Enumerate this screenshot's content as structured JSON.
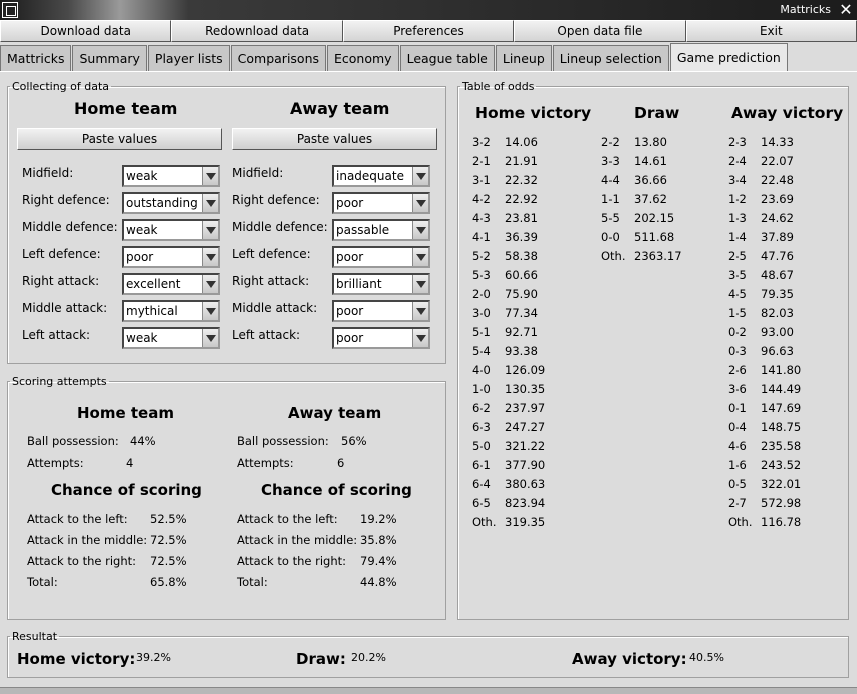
{
  "window": {
    "title": "Mattricks"
  },
  "toolbar": [
    "Download data",
    "Redownload data",
    "Preferences",
    "Open data file",
    "Exit"
  ],
  "tabs": [
    "Mattricks",
    "Summary",
    "Player lists",
    "Comparisons",
    "Economy",
    "League table",
    "Lineup",
    "Lineup selection",
    "Game prediction"
  ],
  "active_tab": "Game prediction",
  "collecting": {
    "title": "Collecting of data",
    "home": {
      "heading": "Home team",
      "paste": "Paste values",
      "rows": [
        {
          "label": "Midfield:",
          "value": "weak"
        },
        {
          "label": "Right defence:",
          "value": "outstanding"
        },
        {
          "label": "Middle defence:",
          "value": "weak"
        },
        {
          "label": "Left defence:",
          "value": "poor"
        },
        {
          "label": "Right attack:",
          "value": "excellent"
        },
        {
          "label": "Middle attack:",
          "value": "mythical"
        },
        {
          "label": "Left attack:",
          "value": "weak"
        }
      ]
    },
    "away": {
      "heading": "Away team",
      "paste": "Paste values",
      "rows": [
        {
          "label": "Midfield:",
          "value": "inadequate"
        },
        {
          "label": "Right defence:",
          "value": "poor"
        },
        {
          "label": "Middle defence:",
          "value": "passable"
        },
        {
          "label": "Left defence:",
          "value": "poor"
        },
        {
          "label": "Right attack:",
          "value": "brilliant"
        },
        {
          "label": "Middle attack:",
          "value": "poor"
        },
        {
          "label": "Left attack:",
          "value": "poor"
        }
      ]
    }
  },
  "scoring": {
    "title": "Scoring attempts",
    "home": {
      "heading": "Home team",
      "possession_label": "Ball possession:",
      "possession": "44%",
      "attempts_label": "Attempts:",
      "attempts": "4",
      "chance_heading": "Chance of scoring",
      "left_label": "Attack to the left:",
      "left": "52.5%",
      "middle_label": "Attack in the middle:",
      "middle": "72.5%",
      "right_label": "Attack to the right:",
      "right": "72.5%",
      "total_label": "Total:",
      "total": "65.8%"
    },
    "away": {
      "heading": "Away team",
      "possession_label": "Ball possession:",
      "possession": "56%",
      "attempts_label": "Attempts:",
      "attempts": "6",
      "chance_heading": "Chance of scoring",
      "left_label": "Attack to the left:",
      "left": "19.2%",
      "middle_label": "Attack in the middle:",
      "middle": "35.8%",
      "right_label": "Attack to the right:",
      "right": "79.4%",
      "total_label": "Total:",
      "total": "44.8%"
    }
  },
  "odds": {
    "title": "Table of odds",
    "home_heading": "Home victory",
    "draw_heading": "Draw",
    "away_heading": "Away victory",
    "home": [
      [
        "3-2",
        "14.06"
      ],
      [
        "2-1",
        "21.91"
      ],
      [
        "3-1",
        "22.32"
      ],
      [
        "4-2",
        "22.92"
      ],
      [
        "4-3",
        "23.81"
      ],
      [
        "4-1",
        "36.39"
      ],
      [
        "5-2",
        "58.38"
      ],
      [
        "5-3",
        "60.66"
      ],
      [
        "2-0",
        "75.90"
      ],
      [
        "3-0",
        "77.34"
      ],
      [
        "5-1",
        "92.71"
      ],
      [
        "5-4",
        "93.38"
      ],
      [
        "4-0",
        "126.09"
      ],
      [
        "1-0",
        "130.35"
      ],
      [
        "6-2",
        "237.97"
      ],
      [
        "6-3",
        "247.27"
      ],
      [
        "5-0",
        "321.22"
      ],
      [
        "6-1",
        "377.90"
      ],
      [
        "6-4",
        "380.63"
      ],
      [
        "6-5",
        "823.94"
      ],
      [
        "Oth.",
        "319.35"
      ]
    ],
    "draw": [
      [
        "2-2",
        "13.80"
      ],
      [
        "3-3",
        "14.61"
      ],
      [
        "4-4",
        "36.66"
      ],
      [
        "1-1",
        "37.62"
      ],
      [
        "5-5",
        "202.15"
      ],
      [
        "0-0",
        "511.68"
      ],
      [
        "Oth.",
        "2363.17"
      ]
    ],
    "away": [
      [
        "2-3",
        "14.33"
      ],
      [
        "2-4",
        "22.07"
      ],
      [
        "3-4",
        "22.48"
      ],
      [
        "1-2",
        "23.69"
      ],
      [
        "1-3",
        "24.62"
      ],
      [
        "1-4",
        "37.89"
      ],
      [
        "2-5",
        "47.76"
      ],
      [
        "3-5",
        "48.67"
      ],
      [
        "4-5",
        "79.35"
      ],
      [
        "1-5",
        "82.03"
      ],
      [
        "0-2",
        "93.00"
      ],
      [
        "0-3",
        "96.63"
      ],
      [
        "2-6",
        "141.80"
      ],
      [
        "3-6",
        "144.49"
      ],
      [
        "0-1",
        "147.69"
      ],
      [
        "0-4",
        "148.75"
      ],
      [
        "4-6",
        "235.58"
      ],
      [
        "1-6",
        "243.52"
      ],
      [
        "0-5",
        "322.01"
      ],
      [
        "2-7",
        "572.98"
      ],
      [
        "Oth.",
        "116.78"
      ]
    ]
  },
  "result": {
    "title": "Resultat",
    "home_label": "Home victory:",
    "home": "39.2%",
    "draw_label": "Draw:",
    "draw": "20.2%",
    "away_label": "Away victory:",
    "away": "40.5%"
  }
}
